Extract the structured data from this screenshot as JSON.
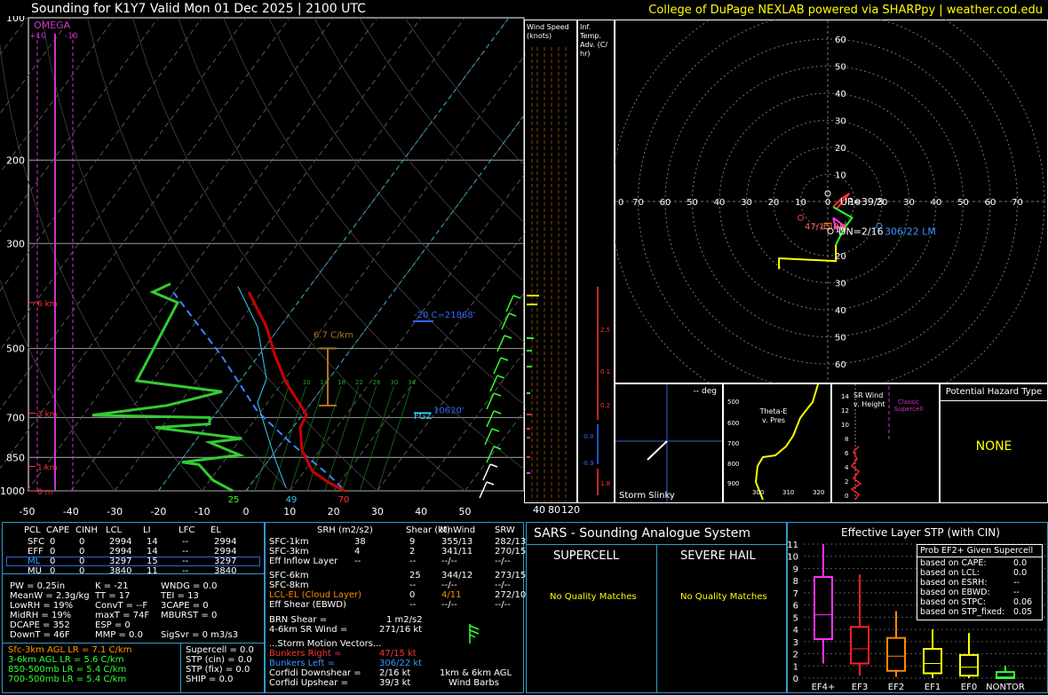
{
  "header": {
    "title": "Sounding for K1Y7 Valid  Mon 01 Dec 2025 | 2100 UTC",
    "credit": "College of DuPage NEXLAB powered via SHARPpy | weather.cod.edu"
  },
  "skewt": {
    "omega_label": "OMEGA",
    "omega_ticks": [
      "+10",
      "-10"
    ],
    "pressure_labels": [
      "100",
      "200",
      "300",
      "500",
      "700",
      "850",
      "1000"
    ],
    "temp_labels": [
      "-50",
      "-40",
      "-30",
      "-20",
      "-10",
      "0",
      "10",
      "20",
      "30",
      "40",
      "50"
    ],
    "height_labels": [
      "6 km",
      "3 km",
      "1 km",
      "0 m"
    ],
    "lapse_label": "6.7 C/km",
    "freezing_label": "-20 C=21868'",
    "wbz_label": "10620'",
    "wbz_prefix": "FGZ",
    "mixing_ratio_labels": [
      "6",
      "10",
      "14",
      "18",
      "22",
      "26",
      "30",
      "34"
    ],
    "surface_labels": [
      "25",
      "49",
      "70"
    ]
  },
  "wind_speed_panel": {
    "title": "Wind Speed (knots)",
    "ticks": [
      "40",
      "80",
      "120"
    ]
  },
  "inf_temp_panel": {
    "title": "Inf. Temp. Adv. (C/ hr)",
    "values": [
      "2.5",
      "0.1",
      "0.2",
      "-0.0",
      "-0.9",
      "1.8"
    ]
  },
  "hodograph": {
    "rings_up": [
      "60",
      "50",
      "40",
      "30",
      "20",
      "10"
    ],
    "rings_down": [
      "10",
      "20",
      "30",
      "40",
      "50",
      "60"
    ],
    "x_labels": [
      "0",
      "70",
      "60",
      "50",
      "40",
      "30",
      "20",
      "10",
      "0",
      "10",
      "20",
      "30",
      "40",
      "50",
      "60",
      "70"
    ],
    "labels": {
      "up": "UP=39/3",
      "dn": "DN=2/16",
      "rm": "47/15 RM",
      "lm": "306/22 LM"
    }
  },
  "storm_slinky": {
    "title": "-- deg",
    "label": "Storm Slinky"
  },
  "theta_panel": {
    "title": "Theta-E v. Pres",
    "yticks": [
      "500",
      "600",
      "700",
      "800",
      "900"
    ],
    "xticks": [
      "300",
      "310",
      "320"
    ]
  },
  "srwind_panel": {
    "title": "SR Wind v. Height",
    "classic": "Classic Supercell",
    "yticks": [
      "14",
      "12",
      "10",
      "8",
      "6",
      "4",
      "2",
      "0"
    ]
  },
  "hazard_panel": {
    "title": "Potential Hazard Type",
    "value": "NONE"
  },
  "parcel_table": {
    "headers": [
      "PCL",
      "CAPE",
      "CINH",
      "LCL",
      "LI",
      "LFC",
      "EL"
    ],
    "rows": [
      [
        "SFC",
        "0",
        "0",
        "2994",
        "14",
        "--",
        "2994"
      ],
      [
        "EFF",
        "0",
        "0",
        "2994",
        "14",
        "--",
        "2994"
      ],
      [
        "ML",
        "0",
        "0",
        "3297",
        "15",
        "--",
        "3297"
      ],
      [
        "MU",
        "0",
        "0",
        "3840",
        "11",
        "--",
        "3840"
      ]
    ]
  },
  "indices": {
    "col1": [
      "PW = 0.25in",
      "MeanW = 2.3g/kg",
      "LowRH = 19%",
      "MidRH = 19%",
      "DCAPE = 352",
      "DownT = 46F"
    ],
    "col2": [
      "K = -21",
      "TT = 17",
      "ConvT = --F",
      "maxT = 74F",
      "ESP = 0",
      "MMP = 0.0"
    ],
    "col3": [
      "WNDG = 0.0",
      "TEI = 13",
      "3CAPE = 0",
      "MBURST = 0",
      "",
      "SigSvr = 0 m3/s3"
    ]
  },
  "lapse_rates": [
    {
      "text": "Sfc-3km AGL LR = 7.1 C/km",
      "color": "#ff9900"
    },
    {
      "text": "3-6km AGL LR = 5.6 C/km",
      "color": "#33ff33"
    },
    {
      "text": "850-500mb LR = 5.4 C/km",
      "color": "#33ff33"
    },
    {
      "text": "700-500mb LR = 5.4 C/km",
      "color": "#33ff33"
    }
  ],
  "severe_params": [
    "Supercell = 0.0",
    "STP (cin) = 0.0",
    "STP (fix) = 0.0",
    "SHIP = 0.0"
  ],
  "kinematics": {
    "headers": [
      "SRH (m2/s2)",
      "Shear (kt)",
      "MnWind",
      "SRW"
    ],
    "rows": [
      [
        "SFC-1km",
        "38",
        "9",
        "355/13",
        "282/13"
      ],
      [
        "SFC-3km",
        "4",
        "2",
        "341/11",
        "270/15"
      ],
      [
        "Eff Inflow Layer",
        "--",
        "--",
        "--/--",
        "--/--"
      ],
      [
        "SFC-6km",
        "",
        "25",
        "344/12",
        "273/15"
      ],
      [
        "SFC-8km",
        "",
        "--",
        "--/--",
        "--/--"
      ],
      [
        "LCL-EL (Cloud Layer)",
        "",
        "0",
        "4/11",
        "272/10"
      ],
      [
        "Eff Shear (EBWD)",
        "",
        "--",
        "--/--",
        "--/--"
      ]
    ],
    "brn": [
      "BRN Shear =",
      "1 m2/s2"
    ],
    "sr46": [
      "4-6km SR Wind =",
      "271/16 kt"
    ],
    "storm_title": "...Storm Motion Vectors...",
    "storm_rows": [
      [
        "Bunkers Right =",
        "47/15 kt"
      ],
      [
        "Bunkers Left =",
        "306/22 kt"
      ],
      [
        "Corfidi Downshear =",
        "2/16 kt"
      ],
      [
        "Corfidi Upshear =",
        "39/3 kt"
      ]
    ],
    "barb_caption": [
      "1km & 6km AGL",
      "Wind Barbs"
    ]
  },
  "sars": {
    "title": "SARS - Sounding Analogue System",
    "supercell": "SUPERCELL",
    "hail": "SEVERE HAIL",
    "no_match": "No Quality Matches"
  },
  "stp_panel": {
    "title": "Effective Layer STP (with CIN)",
    "yticks": [
      "11",
      "10",
      "9",
      "8",
      "7",
      "6",
      "5",
      "4",
      "3",
      "2",
      "1",
      "0"
    ],
    "categories": [
      "EF4+",
      "EF3",
      "EF2",
      "EF1",
      "EF0",
      "NONTOR"
    ],
    "prob_title": "Prob EF2+ Given Supercell",
    "prob_rows": [
      [
        "based on CAPE:",
        "0.0"
      ],
      [
        "based on LCL:",
        "0.0"
      ],
      [
        "based on ESRH:",
        "--"
      ],
      [
        "based on EBWD:",
        "--"
      ],
      [
        "based on STPC:",
        "0.06"
      ],
      [
        "based on STP_fixed:",
        "0.05"
      ]
    ]
  },
  "chart_data": {
    "type": "line",
    "title": "Sounding for K1Y7 Valid  Mon 01 Dec 2025 | 2100 UTC",
    "xlabel": "",
    "ylabel": "",
    "pressure_axis_mb": [
      1000,
      850,
      700,
      500,
      300,
      200,
      100
    ],
    "temperature_axis_c": [
      -50,
      50
    ],
    "series": [
      {
        "name": "",
        "color": "#cc0000",
        "profile": "temperature",
        "points": [
          [
            70,
            1000
          ],
          [
            20,
            950
          ],
          [
            12,
            900
          ],
          [
            10,
            850
          ],
          [
            12,
            800
          ],
          [
            12,
            700
          ],
          [
            14,
            650
          ],
          [
            10,
            600
          ],
          [
            6,
            550
          ],
          [
            4,
            500
          ],
          [
            -4,
            450
          ],
          [
            -10,
            400
          ],
          [
            -16,
            350
          ]
        ]
      },
      {
        "name": "",
        "color": "#33cc33",
        "profile": "dewpoint",
        "points": [
          [
            25,
            1000
          ],
          [
            25,
            950
          ],
          [
            -2,
            900
          ],
          [
            -2,
            850
          ],
          [
            -6,
            800
          ],
          [
            -8,
            750
          ],
          [
            -24,
            700
          ],
          [
            -38,
            690
          ],
          [
            -2,
            650
          ],
          [
            -12,
            550
          ],
          [
            -22,
            450
          ],
          [
            -22,
            400
          ],
          [
            -12,
            350
          ]
        ]
      }
    ],
    "stp_boxes": [
      {
        "category": "EF4+",
        "whisker": [
          1.2,
          11
        ],
        "box": [
          3.2,
          8.3
        ],
        "median": 5.2,
        "color": "#ff33ff"
      },
      {
        "category": "EF3",
        "whisker": [
          0.2,
          8.5
        ],
        "box": [
          1.2,
          4.2
        ],
        "median": 2.4,
        "color": "#ff2222"
      },
      {
        "category": "EF2",
        "whisker": [
          0.1,
          5.5
        ],
        "box": [
          0.6,
          3.3
        ],
        "median": 1.8,
        "color": "#ff8800"
      },
      {
        "category": "EF1",
        "whisker": [
          0.0,
          4.0
        ],
        "box": [
          0.4,
          2.4
        ],
        "median": 1.2,
        "color": "#ffff00"
      },
      {
        "category": "EF0",
        "whisker": [
          0.0,
          3.7
        ],
        "box": [
          0.2,
          1.9
        ],
        "median": 0.9,
        "color": "#ffff00"
      },
      {
        "category": "NONTOR",
        "whisker": [
          0.0,
          1.0
        ],
        "box": [
          0.0,
          0.5
        ],
        "median": 0.1,
        "color": "#33ff33"
      }
    ],
    "stp_ylim": [
      0,
      11
    ]
  }
}
